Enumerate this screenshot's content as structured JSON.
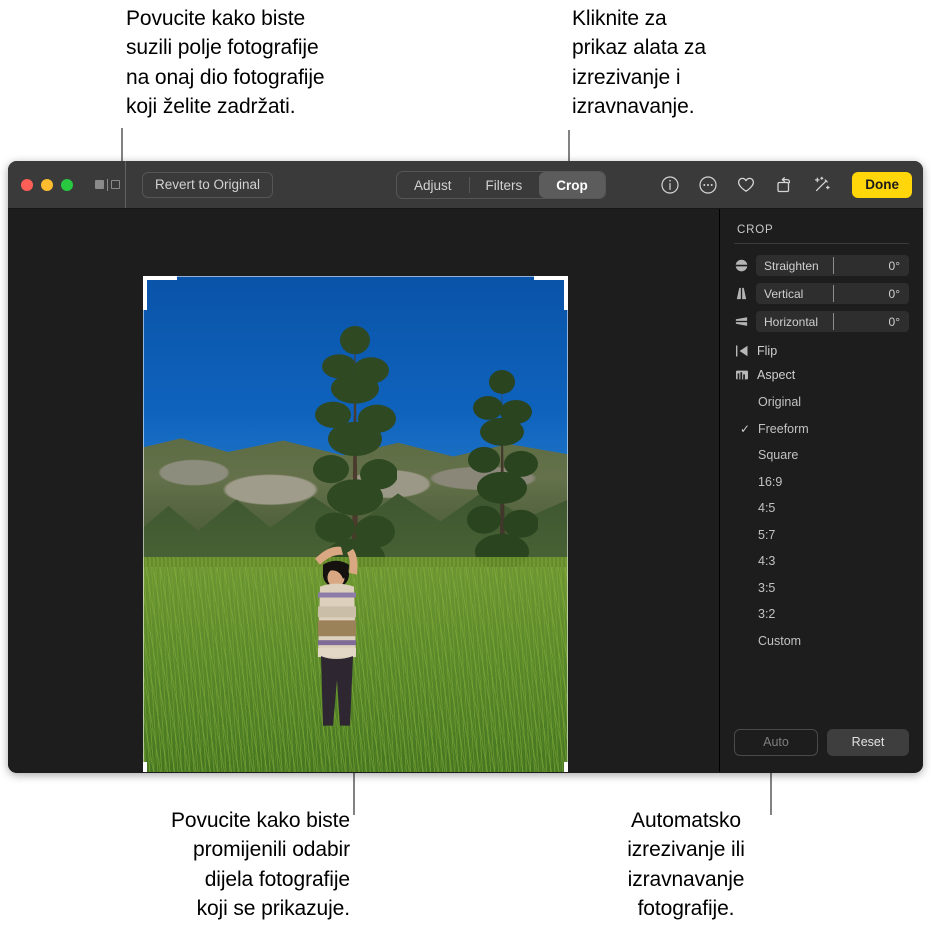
{
  "callouts": {
    "top_left": "Povucite kako biste\nsuzili polje fotografije\nna onaj dio fotografije\nkoji želite zadržati.",
    "top_right": "Kliknite za\nprikaz alata za\nizrezivanje i\nizravnavanje.",
    "bottom_left": "Povucite kako biste\npromijenili odabir\ndijela fotografije\nkoji se prikazuje.",
    "bottom_right": "Automatsko\nizrezivanje ili\nizravnavanje\nfotografije."
  },
  "toolbar": {
    "revert_label": "Revert to Original",
    "tabs": [
      {
        "label": "Adjust",
        "active": false
      },
      {
        "label": "Filters",
        "active": false
      },
      {
        "label": "Crop",
        "active": true
      }
    ],
    "icons": [
      "info-icon",
      "more-options-icon",
      "favorite-heart-icon",
      "rotate-icon",
      "enhance-wand-icon"
    ],
    "done_label": "Done",
    "done_color": "#ffd60a"
  },
  "inspector": {
    "title": "CROP",
    "sliders": [
      {
        "icon": "straighten-icon",
        "label": "Straighten",
        "value": "0°"
      },
      {
        "icon": "vertical-perspective-icon",
        "label": "Vertical",
        "value": "0°"
      },
      {
        "icon": "horizontal-perspective-icon",
        "label": "Horizontal",
        "value": "0°"
      }
    ],
    "menus": [
      {
        "icon": "flip-icon",
        "label": "Flip"
      },
      {
        "icon": "aspect-icon",
        "label": "Aspect"
      }
    ],
    "aspect_options": [
      {
        "label": "Original",
        "checked": false
      },
      {
        "label": "Freeform",
        "checked": true
      },
      {
        "label": "Square",
        "checked": false
      },
      {
        "label": "16:9",
        "checked": false
      },
      {
        "label": "4:5",
        "checked": false
      },
      {
        "label": "5:7",
        "checked": false
      },
      {
        "label": "4:3",
        "checked": false
      },
      {
        "label": "3:5",
        "checked": false
      },
      {
        "label": "3:2",
        "checked": false
      },
      {
        "label": "Custom",
        "checked": false
      }
    ],
    "check_glyph": "✓",
    "auto_label": "Auto",
    "reset_label": "Reset"
  }
}
